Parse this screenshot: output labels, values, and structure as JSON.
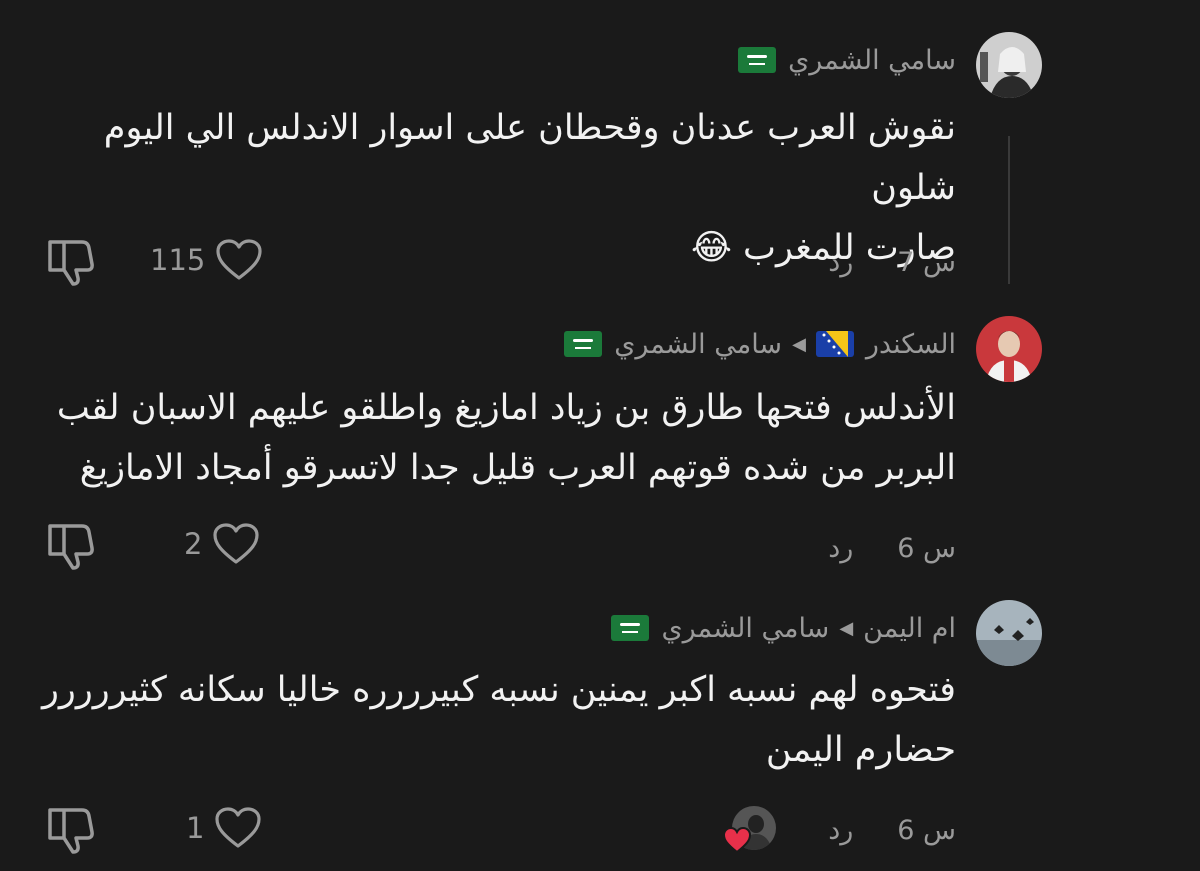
{
  "comments": [
    {
      "author": "سامي الشمري",
      "reply_to": "",
      "text_lines": [
        "نقوش العرب عدنان وقحطان على اسوار الاندلس الي اليوم شلون",
        "صارت للمغرب 😂"
      ],
      "time": "7 س",
      "reply_label": "رد",
      "likes": "115"
    },
    {
      "author": "السكندر",
      "reply_to": "سامي الشمري",
      "text_lines": [
        "الأندلس فتحها طارق بن زياد امازيغ واطلقو عليهم الاسبان لقب",
        "البربر من شده قوتهم العرب قليل جدا لاتسرقو أمجاد الامازيغ"
      ],
      "time": "6 س",
      "reply_label": "رد",
      "likes": "2"
    },
    {
      "author": "ام اليمن",
      "reply_to": "سامي الشمري",
      "text_lines": [
        "فتحوه لهم نسبه اكبر يمنين نسبه كبيرررره خاليا سكانه كثيررررر",
        "حضارم اليمن"
      ],
      "time": "6 س",
      "reply_label": "رد",
      "likes": "1"
    }
  ],
  "icons": {
    "like": "heart-outline-icon",
    "dislike": "thumbs-down-icon",
    "reply_arrow": "triangle-left-icon",
    "creator_liked": "heart-filled-icon"
  },
  "colors": {
    "background": "#1a1a1a",
    "text": "#f2f2f2",
    "muted": "#9a9a9a",
    "heart_red": "#e8304a",
    "saudi_green": "#1b7a3a"
  }
}
